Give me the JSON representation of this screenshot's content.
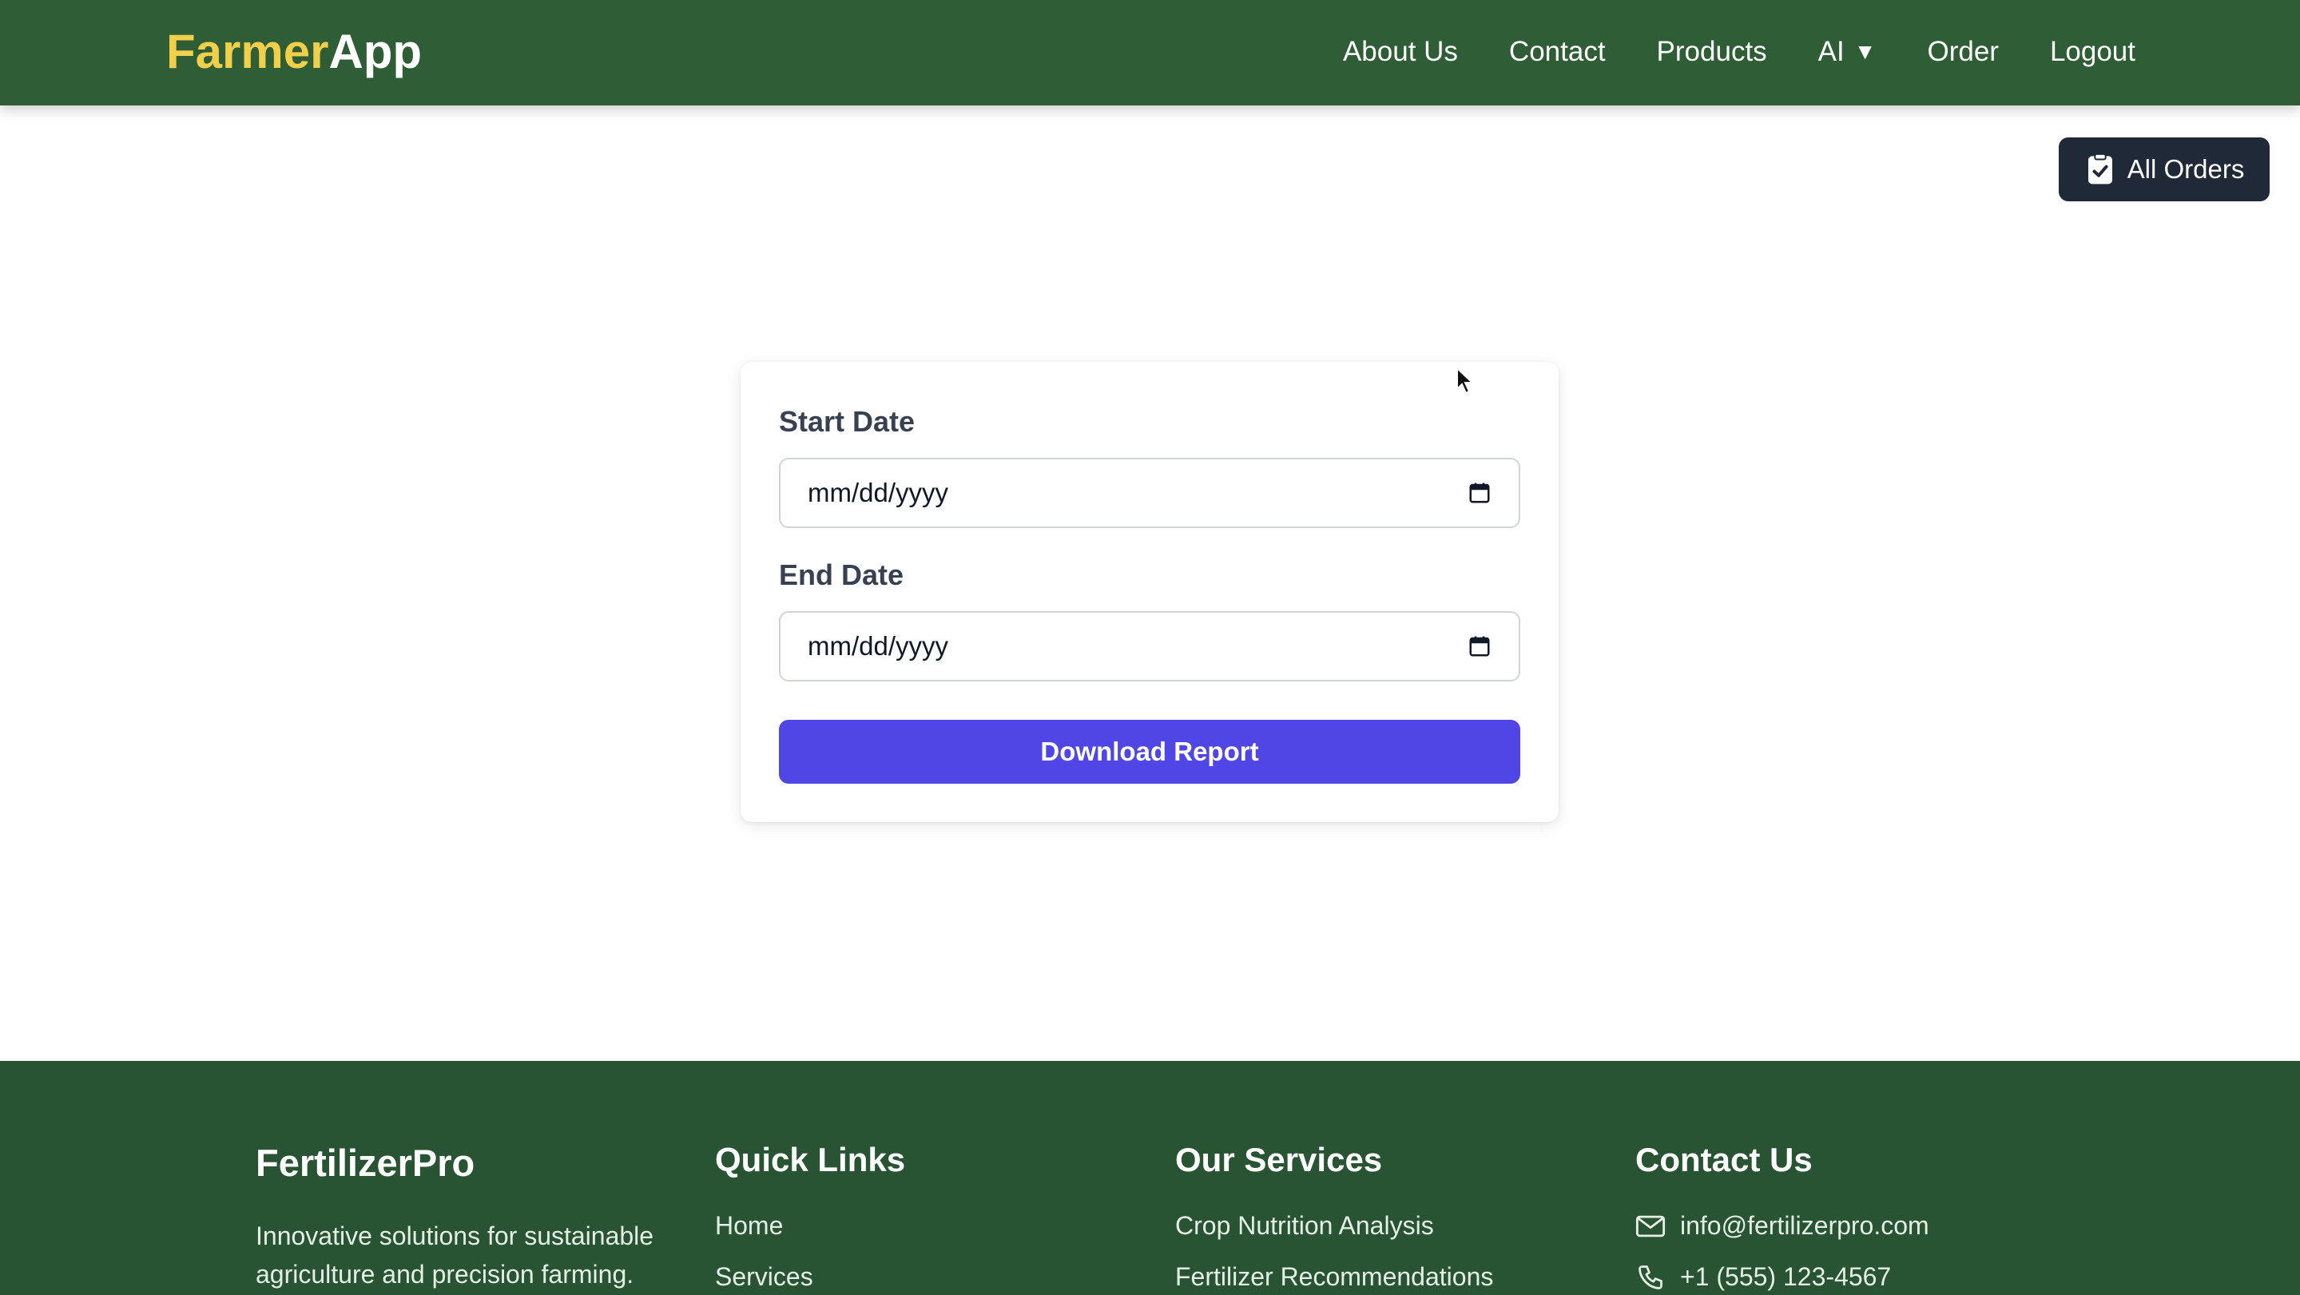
{
  "nav": {
    "logo_part1": "Farmer",
    "logo_part2": "App",
    "links": [
      "About Us",
      "Contact",
      "Products",
      "AI",
      "Order",
      "Logout"
    ],
    "ai_caret": "▼"
  },
  "actions": {
    "all_orders_label": "All Orders"
  },
  "form": {
    "start_label": "Start Date",
    "start_value": "mm/dd/yyyy",
    "end_label": "End Date",
    "end_value": "mm/dd/yyyy",
    "submit_label": "Download Report"
  },
  "footer": {
    "brand": "FertilizerPro",
    "brand_desc": "Innovative solutions for sustainable agriculture and precision farming.",
    "quick_links_title": "Quick Links",
    "quick_links": [
      "Home",
      "Services"
    ],
    "services_title": "Our Services",
    "services": [
      "Crop Nutrition Analysis",
      "Fertilizer Recommendations"
    ],
    "contact_title": "Contact Us",
    "email": "info@fertilizerpro.com",
    "phone": "+1 (555) 123-4567"
  },
  "colors": {
    "navbar": "#2f5e36",
    "footer": "#285434",
    "logo_accent": "#f0cf4b",
    "primary_button": "#4f46e5",
    "dark_button": "#1f2937"
  }
}
